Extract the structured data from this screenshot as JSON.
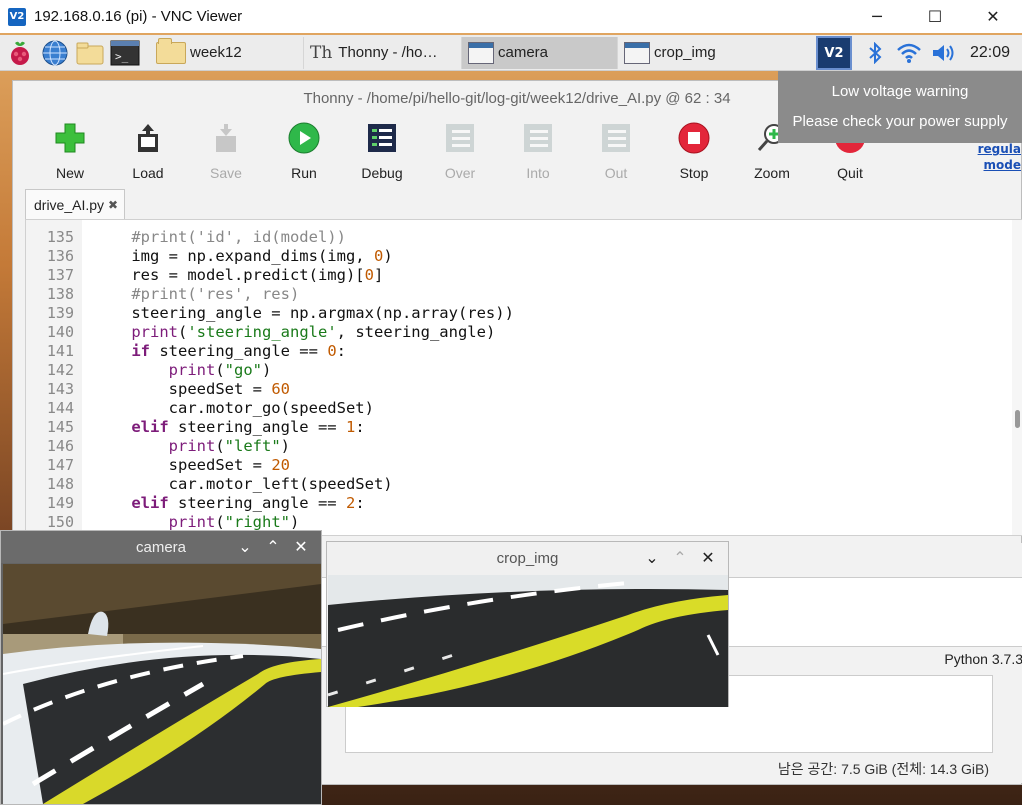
{
  "vnc": {
    "title": "192.168.0.16 (pi) - VNC Viewer",
    "logo": "V2",
    "minimize": "─",
    "maximize": "☐",
    "close": "✕"
  },
  "taskbar": {
    "tasks": [
      {
        "label": "week12",
        "icon": "folder-icon"
      },
      {
        "label": "Thonny  -  /ho…",
        "icon": "thonny-icon"
      },
      {
        "label": "camera",
        "icon": "window-icon",
        "active": true
      },
      {
        "label": "crop_img",
        "icon": "window-icon"
      }
    ],
    "clock": "22:09",
    "tray_logo": "V2"
  },
  "notification": {
    "line1": "Low voltage warning",
    "line2": "Please check your power supply"
  },
  "thonny": {
    "title": "Thonny  -  /home/pi/hello-git/log-git/week12/drive_AI.py  @  62 : 34",
    "toolbar": [
      {
        "label": "New",
        "enabled": true
      },
      {
        "label": "Load",
        "enabled": true
      },
      {
        "label": "Save",
        "enabled": false
      },
      {
        "label": "Run",
        "enabled": true
      },
      {
        "label": "Debug",
        "enabled": true
      },
      {
        "label": "Over",
        "enabled": false
      },
      {
        "label": "Into",
        "enabled": false
      },
      {
        "label": "Out",
        "enabled": false
      },
      {
        "label": "Stop",
        "enabled": true
      },
      {
        "label": "Zoom",
        "enabled": true
      },
      {
        "label": "Quit",
        "enabled": true
      }
    ],
    "help_link_1": "regula",
    "help_link_2": "mode",
    "tab": {
      "label": "drive_AI.py",
      "close": "✖"
    },
    "python_version": "Python 3.7.3",
    "free_space": "남은 공간: 7.5 GiB (전체: 14.3 GiB)",
    "code_lines": [
      {
        "n": "135",
        "tokens": [
          [
            "    ",
            ""
          ],
          [
            "#print('id', id(model))",
            "cm"
          ]
        ]
      },
      {
        "n": "136",
        "tokens": [
          [
            "    img = np.expand_dims(img, ",
            ""
          ],
          [
            "0",
            "num"
          ],
          [
            ")",
            ""
          ]
        ]
      },
      {
        "n": "137",
        "tokens": [
          [
            "    res = model.predict(img)[",
            ""
          ],
          [
            "0",
            "num"
          ],
          [
            "]",
            ""
          ]
        ]
      },
      {
        "n": "138",
        "tokens": [
          [
            "    ",
            ""
          ],
          [
            "#print('res', res)",
            "cm"
          ]
        ]
      },
      {
        "n": "139",
        "tokens": [
          [
            "    steering_angle = np.argmax(np.array(res))",
            ""
          ]
        ]
      },
      {
        "n": "140",
        "tokens": [
          [
            "    ",
            ""
          ],
          [
            "print",
            "bi"
          ],
          [
            "(",
            ""
          ],
          [
            "'steering_angle'",
            "str"
          ],
          [
            ", steering_angle)",
            ""
          ]
        ]
      },
      {
        "n": "141",
        "tokens": [
          [
            "    ",
            ""
          ],
          [
            "if",
            "kw"
          ],
          [
            " steering_angle == ",
            ""
          ],
          [
            "0",
            "num"
          ],
          [
            ":",
            ""
          ]
        ]
      },
      {
        "n": "142",
        "tokens": [
          [
            "        ",
            ""
          ],
          [
            "print",
            "bi"
          ],
          [
            "(",
            ""
          ],
          [
            "\"go\"",
            "str"
          ],
          [
            ")",
            ""
          ]
        ]
      },
      {
        "n": "143",
        "tokens": [
          [
            "        speedSet = ",
            ""
          ],
          [
            "60",
            "num"
          ]
        ]
      },
      {
        "n": "144",
        "tokens": [
          [
            "        car.motor_go(speedSet)",
            ""
          ]
        ]
      },
      {
        "n": "145",
        "tokens": [
          [
            "    ",
            ""
          ],
          [
            "elif",
            "kw"
          ],
          [
            " steering_angle == ",
            ""
          ],
          [
            "1",
            "num"
          ],
          [
            ":",
            ""
          ]
        ]
      },
      {
        "n": "146",
        "tokens": [
          [
            "        ",
            ""
          ],
          [
            "print",
            "bi"
          ],
          [
            "(",
            ""
          ],
          [
            "\"left\"",
            "str"
          ],
          [
            ")",
            ""
          ]
        ]
      },
      {
        "n": "147",
        "tokens": [
          [
            "        speedSet = ",
            ""
          ],
          [
            "20",
            "num"
          ]
        ]
      },
      {
        "n": "148",
        "tokens": [
          [
            "        car.motor_left(speedSet)",
            ""
          ]
        ]
      },
      {
        "n": "149",
        "tokens": [
          [
            "    ",
            ""
          ],
          [
            "elif",
            "kw"
          ],
          [
            " steering_angle == ",
            ""
          ],
          [
            "2",
            "num"
          ],
          [
            ":",
            ""
          ]
        ]
      },
      {
        "n": "150",
        "tokens": [
          [
            "        ",
            ""
          ],
          [
            "print",
            "bi"
          ],
          [
            "(",
            ""
          ],
          [
            "\"right\"",
            "str"
          ],
          [
            ")",
            ""
          ]
        ]
      }
    ]
  },
  "camera_window": {
    "title": "camera",
    "btn_min": "⌄",
    "btn_max": "⌃",
    "btn_close": "✕"
  },
  "crop_window": {
    "title": "crop_img",
    "btn_min": "⌄",
    "btn_max": "⌃",
    "btn_close": "✕"
  }
}
